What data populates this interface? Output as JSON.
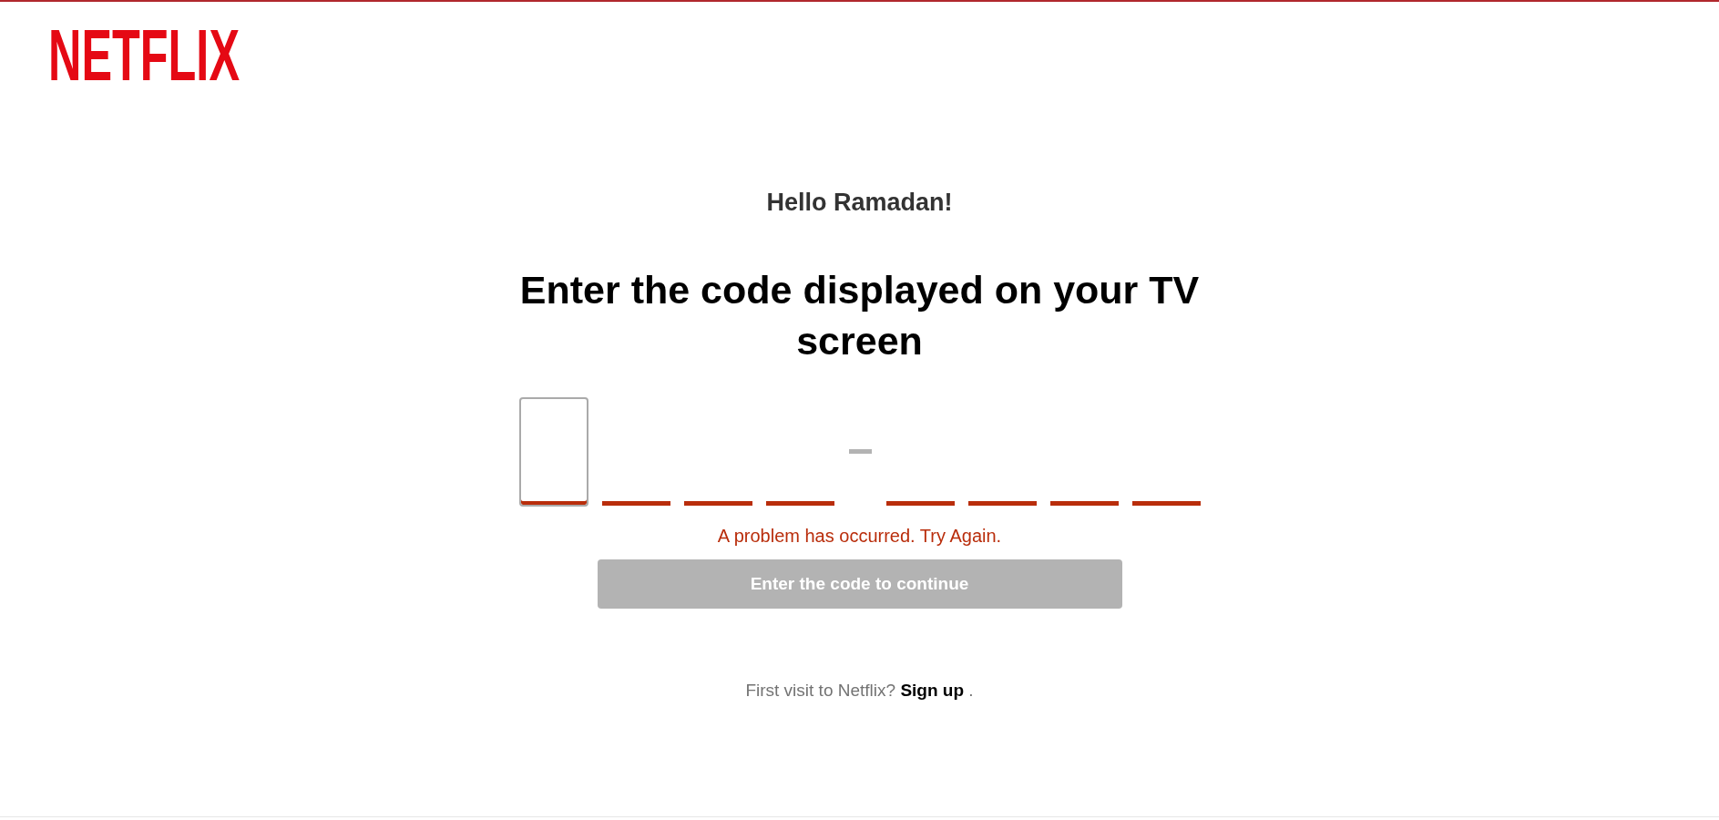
{
  "logo": "NETFLIX",
  "greeting": "Hello Ramadan!",
  "heading": "Enter the code displayed on your TV screen",
  "code": {
    "error": true,
    "groups": [
      {
        "slots": [
          {
            "focused": true
          },
          {
            "focused": false
          },
          {
            "focused": false
          },
          {
            "focused": false
          }
        ]
      },
      {
        "slots": [
          {
            "focused": false
          },
          {
            "focused": false
          },
          {
            "focused": false
          },
          {
            "focused": false
          }
        ]
      }
    ]
  },
  "error_message": "A problem has occurred. Try Again.",
  "submit_button": {
    "label": "Enter the code to continue",
    "disabled": true
  },
  "signup": {
    "prefix": "First visit to Netflix?",
    "link": "Sign up",
    "suffix": "."
  }
}
